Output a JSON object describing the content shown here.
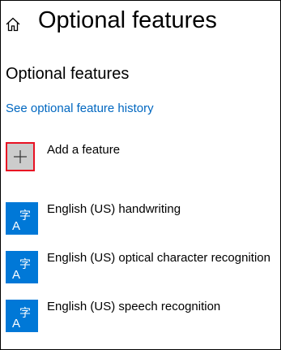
{
  "header": {
    "title": "Optional features",
    "home_icon": "home-icon"
  },
  "section": {
    "title": "Optional features",
    "history_link": "See optional feature history"
  },
  "add_feature": {
    "label": "Add a feature",
    "icon": "plus-icon",
    "tile_color": "#cccccc",
    "focus_color": "#e81123"
  },
  "features": [
    {
      "label": "English (US) handwriting",
      "icon": "language-icon"
    },
    {
      "label": "English (US) optical character recognition",
      "icon": "language-icon"
    },
    {
      "label": "English (US) speech recognition",
      "icon": "language-icon"
    }
  ],
  "colors": {
    "accent": "#0078d7",
    "link": "#0067c0"
  }
}
